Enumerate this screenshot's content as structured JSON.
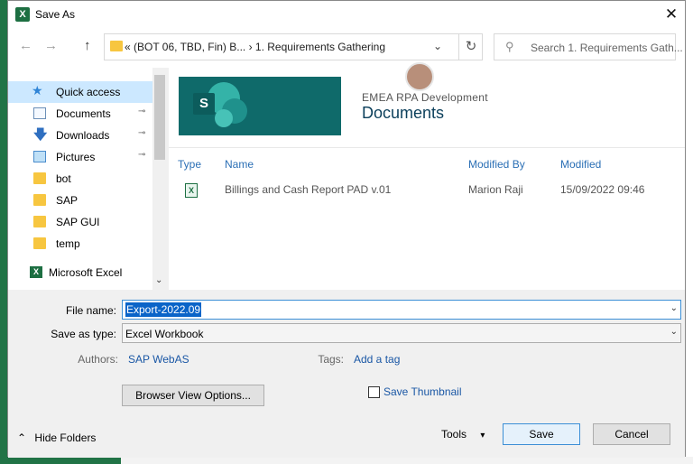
{
  "dialog": {
    "title": "Save As",
    "app_icon_letter": "X",
    "close_glyph": "✕"
  },
  "nav": {
    "back_glyph": "←",
    "forward_glyph": "→",
    "up_glyph": "↑",
    "address_text": "«  (BOT 06, TBD, Fin) B...  ›  1. Requirements Gathering",
    "address_chevron": "⌄",
    "refresh_glyph": "↻",
    "search_placeholder": "Search 1. Requirements Gath...",
    "search_icon": "⚲"
  },
  "sidebar": {
    "items": [
      {
        "label": "Quick access",
        "icon": "star-icon"
      },
      {
        "label": "Documents",
        "icon": "documents-icon",
        "pinned": true
      },
      {
        "label": "Downloads",
        "icon": "download-arrow-icon",
        "pinned": true
      },
      {
        "label": "Pictures",
        "icon": "pictures-icon",
        "pinned": true
      },
      {
        "label": "bot",
        "icon": "folder-icon"
      },
      {
        "label": "SAP",
        "icon": "folder-icon"
      },
      {
        "label": "SAP GUI",
        "icon": "folder-icon"
      },
      {
        "label": "temp",
        "icon": "folder-icon"
      },
      {
        "label": "Microsoft Excel",
        "icon": "excel-icon"
      }
    ],
    "pin_glyph": "📌",
    "star_glyph": "★",
    "download_glyph": "🡇",
    "scroll_down_glyph": "⌄"
  },
  "library": {
    "site_name": "EMEA RPA Development",
    "library_name": "Documents",
    "logo_letter": "S",
    "columns": [
      "Type",
      "Name",
      "Modified By",
      "Modified"
    ],
    "rows": [
      {
        "type_icon": "excel-file-icon",
        "name": "Billings and Cash Report PAD v.01",
        "modified_by": "Marion Raji",
        "modified": "15/09/2022 09:46"
      }
    ]
  },
  "form": {
    "file_name_label": "File name:",
    "file_name_value": "Export-2022.09",
    "save_as_type_label": "Save as type:",
    "save_as_type_value": "Excel Workbook",
    "authors_label": "Authors:",
    "authors_value": "SAP WebAS",
    "tags_label": "Tags:",
    "tags_value": "Add a tag",
    "browser_view_button": "Browser View Options...",
    "save_thumbnail_label": "Save Thumbnail",
    "hide_folders_label": "Hide Folders",
    "hide_folders_glyph": "⌃",
    "tools_label": "Tools",
    "tools_glyph": "▾",
    "save_button": "Save",
    "cancel_button": "Cancel"
  },
  "colors": {
    "excel_green": "#217346",
    "sharepoint_teal": "#0f6a6a",
    "link_blue": "#1a57a5",
    "selection_blue": "#0a64c8",
    "sidebar_selected": "#cce8ff"
  }
}
